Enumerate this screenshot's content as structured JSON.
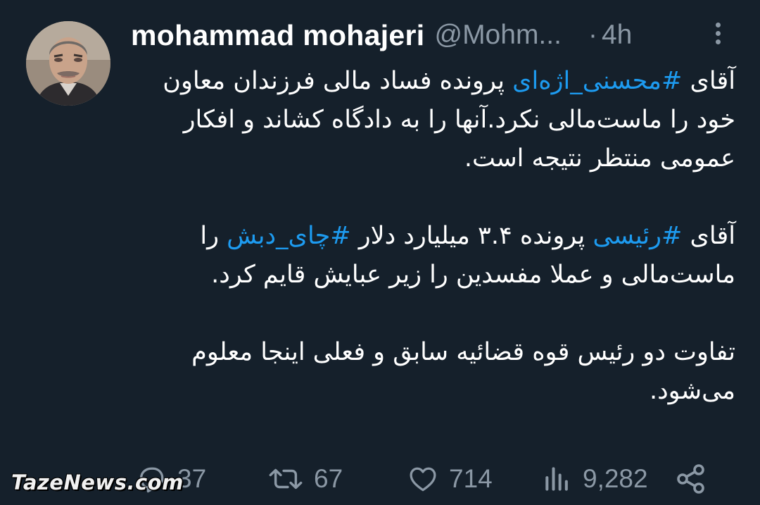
{
  "author": {
    "name": "mohammad mohajeri",
    "handle": "@Mohm...",
    "separator": "·",
    "time": "4h"
  },
  "tweet": {
    "p1_before": "آقای ",
    "p1_tag": "#محسنی_اژه‌ای",
    "p1_after": " پرونده فساد مالی فرزندان معاون خود را ماست‌مالی نکرد.آنها را به دادگاه کشاند و افکار عمومی منتظر نتیجه است.",
    "p2_before": "آقای ",
    "p2_tag1": "#رئیسی",
    "p2_mid": " پرونده ۳.۴ میلیارد دلار ",
    "p2_tag2": "#چای_دبش",
    "p2_after": " را ماست‌مالی و عملا مفسدین را زیر عبایش قایم کرد.",
    "p3": "تفاوت دو رئیس قوه قضائیه سابق و فعلی اینجا معلوم می‌شود."
  },
  "stats": {
    "replies": "37",
    "retweets": "67",
    "likes": "714",
    "views": "9,282"
  },
  "icons": {
    "more": "more-vertical-icon",
    "reply": "reply-icon",
    "retweet": "retweet-icon",
    "like": "heart-icon",
    "views": "views-chart-icon",
    "share": "share-icon"
  },
  "colors": {
    "background": "#15202b",
    "text": "#ffffff",
    "muted": "#8b98a5",
    "hashtag": "#1d9bf0"
  },
  "watermark": "TazeNews.com"
}
